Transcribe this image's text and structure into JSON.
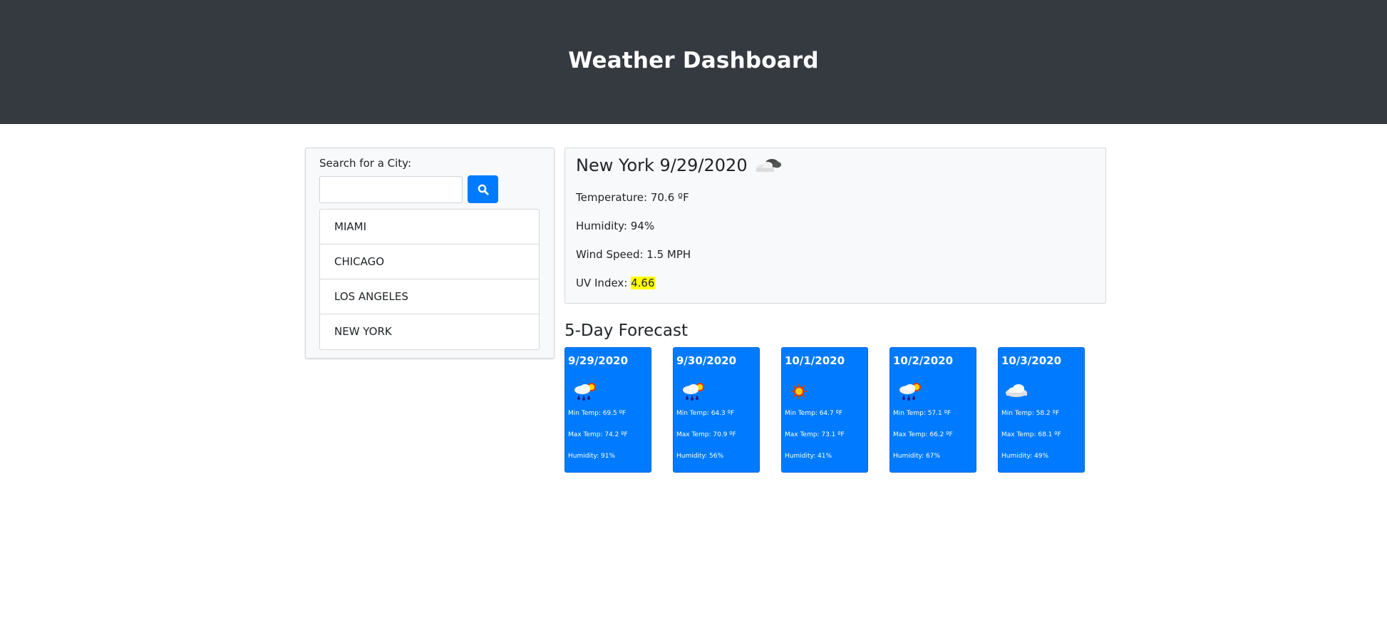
{
  "header": {
    "title": "Weather Dashboard"
  },
  "search": {
    "label": "Search for a City:",
    "input_value": "",
    "placeholder": "",
    "button_icon": "search-icon"
  },
  "history": [
    "MIAMI",
    "CHICAGO",
    "LOS ANGELES",
    "NEW YORK"
  ],
  "current": {
    "city_date": "New York 9/29/2020",
    "icon": "clouds-icon",
    "temperature": "Temperature: 70.6 ºF",
    "humidity": "Humidity: 94%",
    "wind": "Wind Speed: 1.5 MPH",
    "uv_label": "UV Index: ",
    "uv_value": "4.66",
    "uv_color": "#ffff00"
  },
  "forecast": {
    "title": "5-Day Forecast",
    "days": [
      {
        "date": "9/29/2020",
        "icon": "rain-sun-icon",
        "min": "Min Temp: 69.5 ºF",
        "max": "Max Temp: 74.2 ºF",
        "humidity": "Humidity: 91%"
      },
      {
        "date": "9/30/2020",
        "icon": "rain-sun-icon",
        "min": "Min Temp: 64.3 ºF",
        "max": "Max Temp: 70.9 ºF",
        "humidity": "Humidity: 56%"
      },
      {
        "date": "10/1/2020",
        "icon": "sun-icon",
        "min": "Min Temp: 64.7 ºF",
        "max": "Max Temp: 73.1 ºF",
        "humidity": "Humidity: 41%"
      },
      {
        "date": "10/2/2020",
        "icon": "rain-sun-icon",
        "min": "Min Temp: 57.1 ºF",
        "max": "Max Temp: 66.2 ºF",
        "humidity": "Humidity: 67%"
      },
      {
        "date": "10/3/2020",
        "icon": "cloud-icon",
        "min": "Min Temp: 58.2 ºF",
        "max": "Max Temp: 68.1 ºF",
        "humidity": "Humidity: 49%"
      }
    ]
  },
  "colors": {
    "header_bg": "#343a40",
    "accent": "#007bff",
    "panel_bg": "#f8f9fa"
  }
}
